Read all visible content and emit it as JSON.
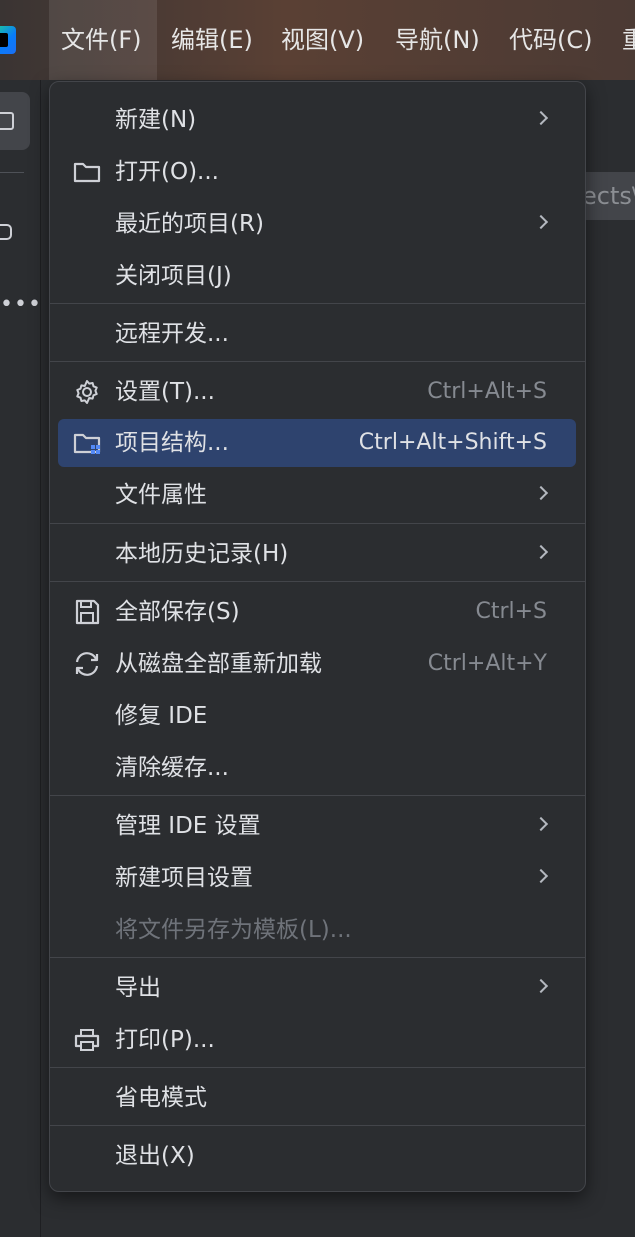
{
  "menubar": {
    "items": [
      {
        "label": "文件(F)"
      },
      {
        "label": "编辑(E)"
      },
      {
        "label": "视图(V)"
      },
      {
        "label": "导航(N)"
      },
      {
        "label": "代码(C)"
      },
      {
        "label": "重"
      }
    ]
  },
  "background": {
    "tab_fragment": "ects\\"
  },
  "file_menu": {
    "items": [
      {
        "label": "新建(N)",
        "shortcut": "",
        "submenu": true
      },
      {
        "label": "打开(O)...",
        "shortcut": "",
        "icon": "folder-icon"
      },
      {
        "label": "最近的项目(R)",
        "shortcut": "",
        "submenu": true
      },
      {
        "label": "关闭项目(J)",
        "shortcut": ""
      },
      {
        "label": "远程开发...",
        "shortcut": ""
      },
      {
        "label": "设置(T)...",
        "shortcut": "Ctrl+Alt+S",
        "icon": "gear-icon"
      },
      {
        "label": "项目结构...",
        "shortcut": "Ctrl+Alt+Shift+S",
        "icon": "project-structure-icon",
        "selected": true
      },
      {
        "label": "文件属性",
        "shortcut": "",
        "submenu": true
      },
      {
        "label": "本地历史记录(H)",
        "shortcut": "",
        "submenu": true
      },
      {
        "label": "全部保存(S)",
        "shortcut": "Ctrl+S",
        "icon": "save-icon"
      },
      {
        "label": "从磁盘全部重新加载",
        "shortcut": "Ctrl+Alt+Y",
        "icon": "reload-icon"
      },
      {
        "label": "修复 IDE",
        "shortcut": ""
      },
      {
        "label": "清除缓存...",
        "shortcut": ""
      },
      {
        "label": "管理 IDE 设置",
        "shortcut": "",
        "submenu": true
      },
      {
        "label": "新建项目设置",
        "shortcut": "",
        "submenu": true
      },
      {
        "label": "将文件另存为模板(L)...",
        "shortcut": "",
        "disabled": true
      },
      {
        "label": "导出",
        "shortcut": "",
        "submenu": true
      },
      {
        "label": "打印(P)...",
        "shortcut": "",
        "icon": "printer-icon"
      },
      {
        "label": "省电模式",
        "shortcut": ""
      },
      {
        "label": "退出(X)",
        "shortcut": ""
      }
    ]
  },
  "colors": {
    "menu_bg": "#2b2d30",
    "selection": "#2e436e",
    "text": "#dfe1e5",
    "shortcut_text": "#868a91",
    "disabled_text": "#6f737a"
  }
}
